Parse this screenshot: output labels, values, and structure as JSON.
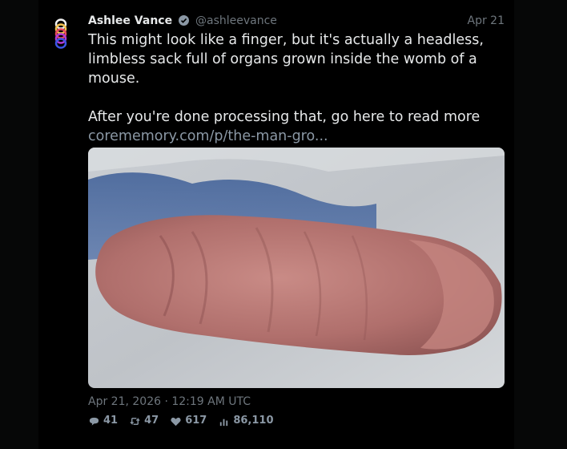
{
  "tweet": {
    "author_name": "Ashlee Vance",
    "author_handle": "@ashleevance",
    "date_short": "Apr 21",
    "text": "This might look like a finger, but it's actually a headless, limbless sack full of organs grown inside the womb of a mouse.\n\nAfter you're done processing that, go here to read more",
    "link_text": "corememory.com/p/the-man-gro...",
    "timestamp": "Apr 21, 2026 · 12:19 AM UTC",
    "stats": {
      "replies": "41",
      "retweets": "47",
      "likes": "617",
      "views": "86,110"
    }
  },
  "icons": {
    "verified": "verified-badge-icon",
    "reply": "reply-icon",
    "retweet": "retweet-icon",
    "like": "heart-icon",
    "views": "bar-chart-icon"
  }
}
